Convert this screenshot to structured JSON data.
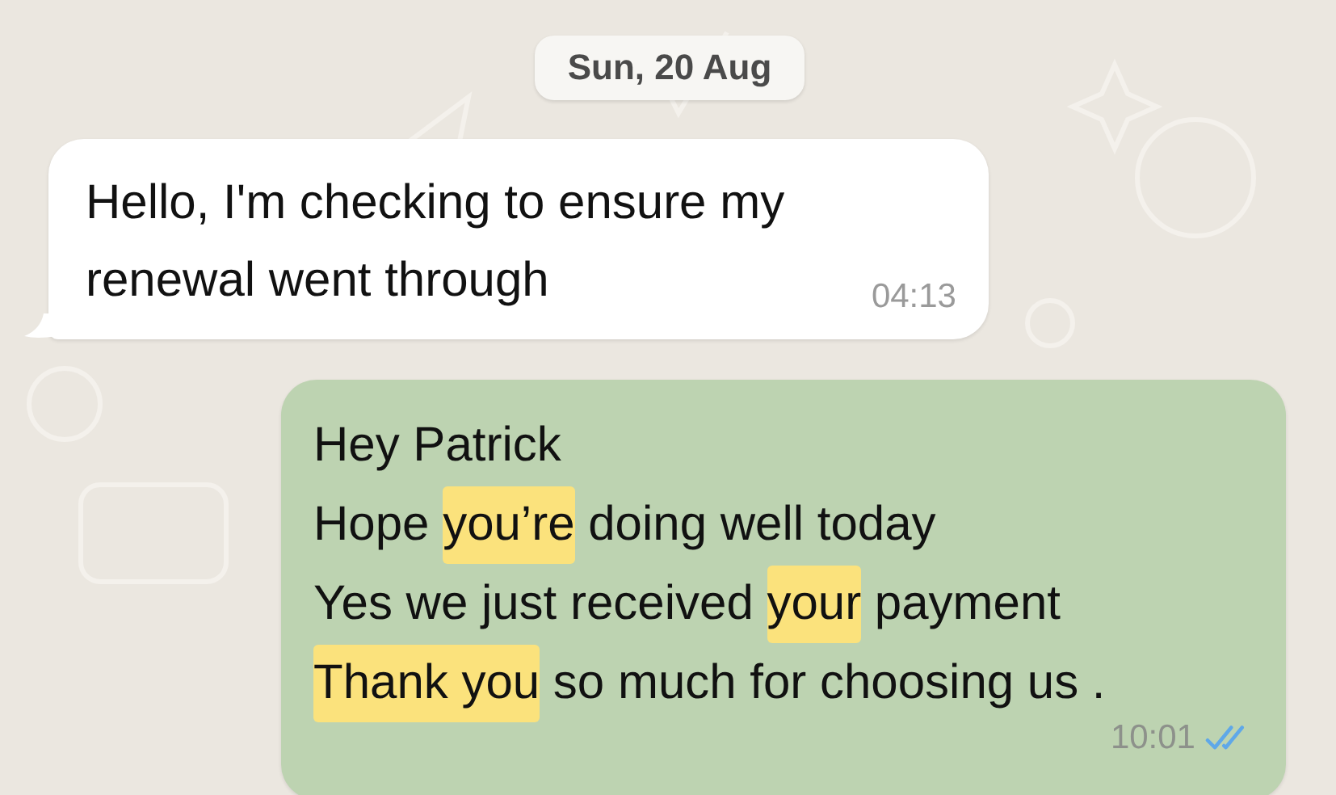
{
  "date_divider": "Sun, 20 Aug",
  "messages": [
    {
      "kind": "incoming",
      "time": "04:13",
      "lines": [
        [
          {
            "text": "Hello, I'm checking to ensure my",
            "highlighted": false
          }
        ],
        [
          {
            "text": "renewal went through",
            "highlighted": false
          }
        ]
      ]
    },
    {
      "kind": "outgoing",
      "time": "10:01",
      "read": true,
      "lines": [
        [
          {
            "text": "Hey Patrick",
            "highlighted": false
          }
        ],
        [
          {
            "text": "Hope ",
            "highlighted": false
          },
          {
            "text": "you’re",
            "highlighted": true
          },
          {
            "text": " doing well today",
            "highlighted": false
          }
        ],
        [
          {
            "text": "Yes we just received ",
            "highlighted": false
          },
          {
            "text": "your",
            "highlighted": true
          },
          {
            "text": " payment",
            "highlighted": false
          }
        ],
        [
          {
            "text": "Thank you",
            "highlighted": true
          },
          {
            "text": " so much for choosing us .",
            "highlighted": false
          }
        ]
      ]
    }
  ]
}
